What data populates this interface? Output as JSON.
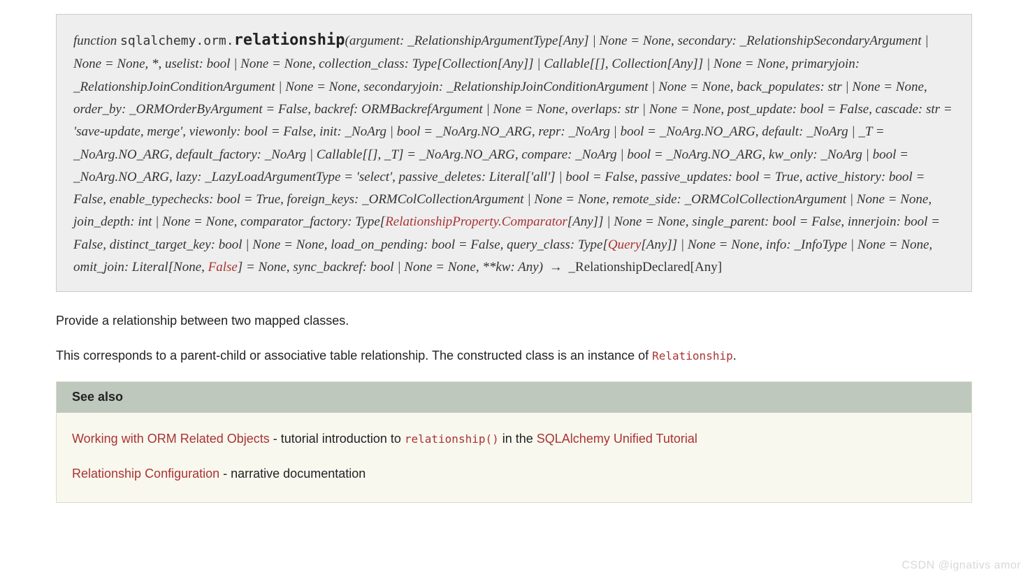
{
  "signature": {
    "prefix": "function ",
    "module": "sqlalchemy.orm.",
    "name": "relationship",
    "params_before_link1": "(argument: _RelationshipArgumentType[Any] | None = None, secondary: _RelationshipSecondaryArgument | None = None, *, uselist: bool | None = None, collection_class: Type[Collection[Any]] | Callable[[], Collection[Any]] | None = None, primaryjoin: _RelationshipJoinConditionArgument | None = None, secondaryjoin: _RelationshipJoinConditionArgument | None = None, back_populates: str | None = None, order_by: _ORMOrderByArgument = False, backref: ORMBackrefArgument | None = None, overlaps: str | None = None, post_update: bool = False, cascade: str = 'save-update, merge', viewonly: bool = False, init: _NoArg | bool = _NoArg.NO_ARG, repr: _NoArg | bool = _NoArg.NO_ARG, default: _NoArg | _T = _NoArg.NO_ARG, default_factory: _NoArg | Callable[[], _T] = _NoArg.NO_ARG, compare: _NoArg | bool = _NoArg.NO_ARG, kw_only: _NoArg | bool = _NoArg.NO_ARG, lazy: _LazyLoadArgumentType = 'select', passive_deletes: Literal['all'] | bool = False, passive_updates: bool = True, active_history: bool = False, enable_typechecks: bool = True, foreign_keys: _ORMColCollectionArgument | None = None, remote_side: _ORMColCollectionArgument | None = None, join_depth: int | None = None, comparator_factory: Type[",
    "link1_text": "RelationshipProperty.Comparator",
    "params_mid1": "[Any]] | None = None, single_parent: bool = False, innerjoin: bool = False, distinct_target_key: bool | None = None, load_on_pending: bool = False, query_class: Type[",
    "link2_text": "Query",
    "params_mid2": "[Any]] | None = None, info: _InfoType | None = None, omit_join: Literal[None, ",
    "link3_text": "False",
    "params_after": "] = None, sync_backref: bool | None = None, **kw: Any)",
    "arrow": "→",
    "return_type": "_RelationshipDeclared[Any]"
  },
  "description": {
    "para1": "Provide a relationship between two mapped classes.",
    "para2_a": "This corresponds to a parent-child or associative table relationship. The constructed class is an instance of ",
    "para2_code": "Relationship",
    "para2_b": "."
  },
  "seealso": {
    "title": "See also",
    "item1_link1": "Working with ORM Related Objects",
    "item1_mid1": " - tutorial introduction to ",
    "item1_code": "relationship()",
    "item1_mid2": " in the ",
    "item1_link2": "SQLAlchemy Unified Tutorial",
    "item2_link": "Relationship Configuration",
    "item2_rest": " - narrative documentation"
  },
  "watermark": "CSDN @ignativs  amor"
}
